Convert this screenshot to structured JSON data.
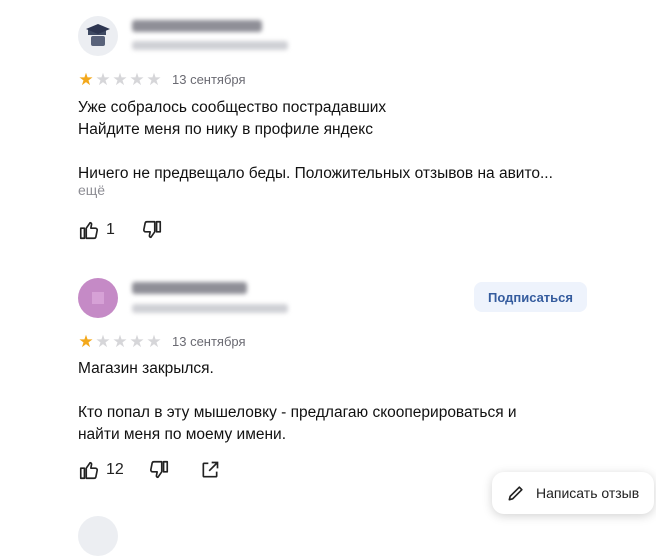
{
  "reviews": [
    {
      "rating": 1,
      "max_rating": 5,
      "date": "13 сентября",
      "text": "Уже собралось сообщество пострадавших\nНайдите меня по нику в профиле яндекс\n\nНичего не предвещало беды. Положительных отзывов на авито...",
      "more_label": "ещё",
      "likes": "1"
    },
    {
      "rating": 1,
      "max_rating": 5,
      "date": "13 сентября",
      "text": "Магазин закрылся.\n\nКто попал в эту мышеловку - предлагаю скооперироваться и\nнайти меня по моему имени.",
      "likes": "12",
      "subscribe_label": "Подписаться"
    }
  ],
  "icons": {
    "like": "thumbs-up-icon",
    "dislike": "thumbs-down-icon",
    "share": "share-icon",
    "write": "pencil-icon"
  },
  "write_review_label": "Написать отзыв",
  "colors": {
    "star_active": "#f3a81b",
    "star_inactive": "#d6d6d9",
    "subscribe_bg": "#eef3fc",
    "subscribe_text": "#355c9e"
  }
}
